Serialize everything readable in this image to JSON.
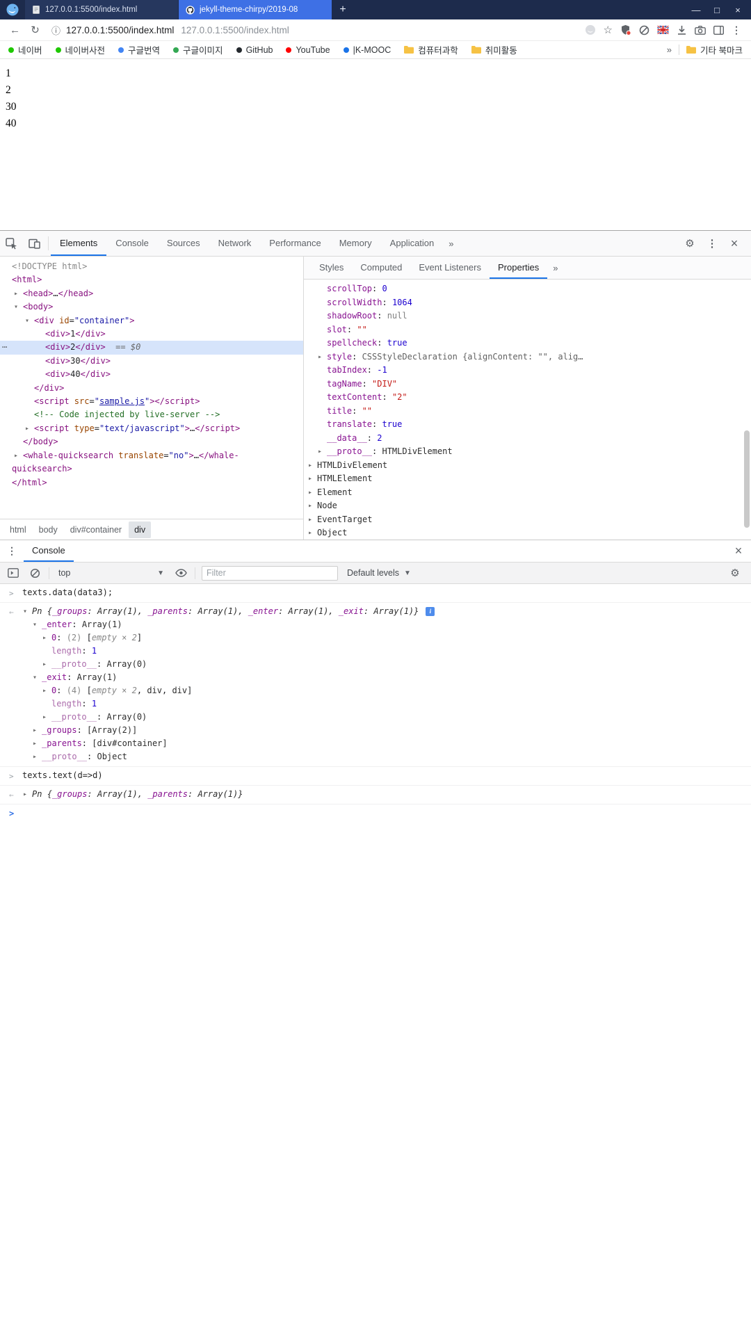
{
  "window": {
    "tabs": [
      {
        "title": "127.0.0.1:5500/index.html",
        "active": false
      },
      {
        "title": "jekyll-theme-chirpy/2019-08",
        "active": true
      }
    ],
    "new_tab_label": "+",
    "controls": {
      "minimize": "—",
      "maximize": "□",
      "close": "×"
    }
  },
  "addressbar": {
    "back_icon": "←",
    "reload_icon": "↻",
    "info_icon": "ⓘ",
    "url_primary": "127.0.0.1:5500/index.html",
    "url_secondary": "127.0.0.1:5500/index.html",
    "star_icon": "☆",
    "menu_icon": "⋮"
  },
  "bookmarks": {
    "items": [
      {
        "label": "네이버",
        "icon": "dot",
        "color": "#1ec800"
      },
      {
        "label": "네이버사전",
        "icon": "dot",
        "color": "#1ec800"
      },
      {
        "label": "구글번역",
        "icon": "dot",
        "color": "#4285f4"
      },
      {
        "label": "구글이미지",
        "icon": "dot",
        "color": "#34a853"
      },
      {
        "label": "GitHub",
        "icon": "dot",
        "color": "#24292e"
      },
      {
        "label": "YouTube",
        "icon": "dot",
        "color": "#ff0000"
      },
      {
        "label": "|K-MOOC",
        "icon": "dot",
        "color": "#1a73e8"
      },
      {
        "label": "컴퓨터과학",
        "icon": "folder",
        "color": "#f6c244"
      },
      {
        "label": "취미활동",
        "icon": "folder",
        "color": "#f6c244"
      }
    ],
    "overflow_icon": "»",
    "other_bookmarks": {
      "label": "기타 북마크"
    }
  },
  "page": {
    "lines": [
      "1",
      "2",
      "30",
      "40"
    ]
  },
  "devtools": {
    "tabbar": {
      "tabs": [
        "Elements",
        "Console",
        "Sources",
        "Network",
        "Performance",
        "Memory",
        "Application"
      ],
      "active": "Elements",
      "overflow_icon": "»",
      "settings_icon": "⚙",
      "menu_icon": "⋮",
      "close_icon": "×"
    },
    "dom_tree": [
      {
        "ind": 0,
        "seg": [
          [
            "<!DOCTYPE html>",
            "gray"
          ]
        ]
      },
      {
        "ind": 0,
        "seg": [
          [
            "<html>",
            "tag"
          ]
        ]
      },
      {
        "ind": 1,
        "arrow": "closed",
        "seg": [
          [
            "<head>",
            "tag"
          ],
          [
            "…",
            "txt"
          ],
          [
            "</head>",
            "tag"
          ]
        ]
      },
      {
        "ind": 1,
        "arrow": "open",
        "seg": [
          [
            "<body>",
            "tag"
          ]
        ]
      },
      {
        "ind": 2,
        "arrow": "open",
        "seg": [
          [
            "<div ",
            "tag"
          ],
          [
            "id",
            "attr"
          ],
          [
            "=",
            "txt"
          ],
          [
            "\"container\"",
            "val"
          ],
          [
            ">",
            "tag"
          ]
        ]
      },
      {
        "ind": 3,
        "seg": [
          [
            "<div>",
            "tag"
          ],
          [
            "1",
            "txt"
          ],
          [
            "</div>",
            "tag"
          ]
        ]
      },
      {
        "ind": 3,
        "sel": true,
        "dots": true,
        "seg": [
          [
            "<div>",
            "tag"
          ],
          [
            "2",
            "txt"
          ],
          [
            "</div>",
            "tag"
          ],
          [
            "  ",
            "txt"
          ],
          [
            "== $0",
            "meta"
          ]
        ]
      },
      {
        "ind": 3,
        "seg": [
          [
            "<div>",
            "tag"
          ],
          [
            "30",
            "txt"
          ],
          [
            "</div>",
            "tag"
          ]
        ]
      },
      {
        "ind": 3,
        "seg": [
          [
            "<div>",
            "tag"
          ],
          [
            "40",
            "txt"
          ],
          [
            "</div>",
            "tag"
          ]
        ]
      },
      {
        "ind": 2,
        "seg": [
          [
            "</div>",
            "tag"
          ]
        ]
      },
      {
        "ind": 2,
        "seg": [
          [
            "<script ",
            "tag"
          ],
          [
            "src",
            "attr"
          ],
          [
            "=",
            "txt"
          ],
          [
            "\"",
            "val"
          ],
          [
            "sample.js",
            "link"
          ],
          [
            "\"",
            "val"
          ],
          [
            ">",
            "tag"
          ],
          [
            "</script>",
            "tag"
          ]
        ]
      },
      {
        "ind": 2,
        "seg": [
          [
            "<!-- Code injected by live-server -->",
            "com"
          ]
        ]
      },
      {
        "ind": 2,
        "arrow": "closed",
        "seg": [
          [
            "<script ",
            "tag"
          ],
          [
            "type",
            "attr"
          ],
          [
            "=",
            "txt"
          ],
          [
            "\"text/javascript\"",
            "val"
          ],
          [
            ">",
            "tag"
          ],
          [
            "…",
            "txt"
          ],
          [
            "</script>",
            "tag"
          ]
        ]
      },
      {
        "ind": 1,
        "seg": [
          [
            "</body>",
            "tag"
          ]
        ]
      },
      {
        "ind": 1,
        "arrow": "closed",
        "seg": [
          [
            "<whale-quicksearch ",
            "tag"
          ],
          [
            "translate",
            "attr"
          ],
          [
            "=",
            "txt"
          ],
          [
            "\"no\"",
            "val"
          ],
          [
            ">",
            "tag"
          ],
          [
            "…",
            "txt"
          ],
          [
            "</whale-",
            "tag"
          ]
        ]
      },
      {
        "ind": 0,
        "seg": [
          [
            "quicksearch>",
            "tag"
          ]
        ]
      },
      {
        "ind": 0,
        "seg": [
          [
            "</html>",
            "tag"
          ]
        ]
      }
    ],
    "sidebar": {
      "tabs": [
        "Styles",
        "Computed",
        "Event Listeners",
        "Properties"
      ],
      "active": "Properties",
      "overflow_icon": "»",
      "properties": [
        {
          "lvl": 1,
          "seg": [
            [
              "scrollTop",
              "name"
            ],
            [
              ": ",
              "txt"
            ],
            [
              "0",
              "num"
            ]
          ]
        },
        {
          "lvl": 1,
          "seg": [
            [
              "scrollWidth",
              "name"
            ],
            [
              ": ",
              "txt"
            ],
            [
              "1064",
              "num"
            ]
          ]
        },
        {
          "lvl": 1,
          "seg": [
            [
              "shadowRoot",
              "name"
            ],
            [
              ": ",
              "txt"
            ],
            [
              "null",
              "null"
            ]
          ]
        },
        {
          "lvl": 1,
          "seg": [
            [
              "slot",
              "name"
            ],
            [
              ": ",
              "txt"
            ],
            [
              "\"\"",
              "str"
            ]
          ]
        },
        {
          "lvl": 1,
          "seg": [
            [
              "spellcheck",
              "name"
            ],
            [
              ": ",
              "txt"
            ],
            [
              "true",
              "num"
            ]
          ]
        },
        {
          "lvl": 1,
          "arrow": true,
          "seg": [
            [
              "style",
              "name"
            ],
            [
              ": ",
              "txt"
            ],
            [
              "CSSStyleDeclaration {alignContent: \"\", alig…",
              "prev"
            ]
          ]
        },
        {
          "lvl": 1,
          "seg": [
            [
              "tabIndex",
              "name"
            ],
            [
              ": ",
              "txt"
            ],
            [
              "-1",
              "num"
            ]
          ]
        },
        {
          "lvl": 1,
          "seg": [
            [
              "tagName",
              "name"
            ],
            [
              ": ",
              "txt"
            ],
            [
              "\"DIV\"",
              "str"
            ]
          ]
        },
        {
          "lvl": 1,
          "seg": [
            [
              "textContent",
              "name"
            ],
            [
              ": ",
              "txt"
            ],
            [
              "\"2\"",
              "str"
            ]
          ]
        },
        {
          "lvl": 1,
          "seg": [
            [
              "title",
              "name"
            ],
            [
              ": ",
              "txt"
            ],
            [
              "\"\"",
              "str"
            ]
          ]
        },
        {
          "lvl": 1,
          "seg": [
            [
              "translate",
              "name"
            ],
            [
              ": ",
              "txt"
            ],
            [
              "true",
              "num"
            ]
          ]
        },
        {
          "lvl": 1,
          "seg": [
            [
              "__data__",
              "name"
            ],
            [
              ": ",
              "txt"
            ],
            [
              "2",
              "num"
            ]
          ]
        },
        {
          "lvl": 1,
          "arrow": true,
          "seg": [
            [
              "__proto__",
              "name"
            ],
            [
              ": ",
              "txt"
            ],
            [
              "HTMLDivElement",
              "obj"
            ]
          ]
        },
        {
          "lvl": 0,
          "arrow": true,
          "seg": [
            [
              "HTMLDivElement",
              "obj"
            ]
          ]
        },
        {
          "lvl": 0,
          "arrow": true,
          "seg": [
            [
              "HTMLElement",
              "obj"
            ]
          ]
        },
        {
          "lvl": 0,
          "arrow": true,
          "seg": [
            [
              "Element",
              "obj"
            ]
          ]
        },
        {
          "lvl": 0,
          "arrow": true,
          "seg": [
            [
              "Node",
              "obj"
            ]
          ]
        },
        {
          "lvl": 0,
          "arrow": true,
          "seg": [
            [
              "EventTarget",
              "obj"
            ]
          ]
        },
        {
          "lvl": 0,
          "arrow": true,
          "seg": [
            [
              "Object",
              "obj"
            ]
          ]
        }
      ]
    },
    "breadcrumbs": {
      "items": [
        "html",
        "body",
        "div#container",
        "div"
      ],
      "selected": "div"
    },
    "console": {
      "title": "Console",
      "context": "top",
      "filter_placeholder": "Filter",
      "levels_label": "Default levels",
      "entries": [
        {
          "kind": "command",
          "text": "texts.data(data3);"
        },
        {
          "kind": "result",
          "rows": [
            {
              "ind": 0,
              "arrow": "open",
              "info": true,
              "seg": [
                [
                  "Pn ",
                  "pv"
                ],
                [
                  "{",
                  "pv"
                ],
                [
                  "_groups",
                  "pvn"
                ],
                [
                  ": Array(1), ",
                  "pv"
                ],
                [
                  "_parents",
                  "pvn"
                ],
                [
                  ": Array(1), ",
                  "pv"
                ],
                [
                  "_enter",
                  "pvn"
                ],
                [
                  ": Array(1), ",
                  "pv"
                ],
                [
                  "_exit",
                  "pvn"
                ],
                [
                  ": Array(1)}",
                  "pv"
                ]
              ]
            },
            {
              "ind": 1,
              "arrow": "open",
              "seg": [
                [
                  "_enter",
                  "name"
                ],
                [
                  ": ",
                  "txt"
                ],
                [
                  "Array(1)",
                  "obj"
                ]
              ]
            },
            {
              "ind": 2,
              "arrow": "closed",
              "seg": [
                [
                  "0",
                  "name"
                ],
                [
                  ": ",
                  "txt"
                ],
                [
                  "(2) ",
                  "gray"
                ],
                [
                  "[",
                  "txt"
                ],
                [
                  "empty × 2",
                  "grayit"
                ],
                [
                  "]",
                  "txt"
                ]
              ]
            },
            {
              "ind": 2,
              "seg": [
                [
                  "length",
                  "name2"
                ],
                [
                  ": ",
                  "txt"
                ],
                [
                  "1",
                  "num"
                ]
              ]
            },
            {
              "ind": 2,
              "arrow": "closed",
              "seg": [
                [
                  "__proto__",
                  "name2"
                ],
                [
                  ": ",
                  "txt"
                ],
                [
                  "Array(0)",
                  "obj"
                ]
              ]
            },
            {
              "ind": 1,
              "arrow": "open",
              "seg": [
                [
                  "_exit",
                  "name"
                ],
                [
                  ": ",
                  "txt"
                ],
                [
                  "Array(1)",
                  "obj"
                ]
              ]
            },
            {
              "ind": 2,
              "arrow": "closed",
              "seg": [
                [
                  "0",
                  "name"
                ],
                [
                  ": ",
                  "txt"
                ],
                [
                  "(4) ",
                  "gray"
                ],
                [
                  "[",
                  "txt"
                ],
                [
                  "empty × 2",
                  "grayit"
                ],
                [
                  ", ",
                  "txt"
                ],
                [
                  "div",
                  "obj"
                ],
                [
                  ", ",
                  "txt"
                ],
                [
                  "div",
                  "obj"
                ],
                [
                  "]",
                  "txt"
                ]
              ]
            },
            {
              "ind": 2,
              "seg": [
                [
                  "length",
                  "name2"
                ],
                [
                  ": ",
                  "txt"
                ],
                [
                  "1",
                  "num"
                ]
              ]
            },
            {
              "ind": 2,
              "arrow": "closed",
              "seg": [
                [
                  "__proto__",
                  "name2"
                ],
                [
                  ": ",
                  "txt"
                ],
                [
                  "Array(0)",
                  "obj"
                ]
              ]
            },
            {
              "ind": 1,
              "arrow": "closed",
              "seg": [
                [
                  "_groups",
                  "name"
                ],
                [
                  ": ",
                  "txt"
                ],
                [
                  "[Array(2)]",
                  "obj"
                ]
              ]
            },
            {
              "ind": 1,
              "arrow": "closed",
              "seg": [
                [
                  "_parents",
                  "name"
                ],
                [
                  ": ",
                  "txt"
                ],
                [
                  "[div#container]",
                  "obj"
                ]
              ]
            },
            {
              "ind": 1,
              "arrow": "closed",
              "seg": [
                [
                  "__proto__",
                  "name2"
                ],
                [
                  ": ",
                  "txt"
                ],
                [
                  "Object",
                  "obj"
                ]
              ]
            }
          ]
        },
        {
          "kind": "command",
          "text": "texts.text(d=>d)"
        },
        {
          "kind": "result",
          "rows": [
            {
              "ind": 0,
              "arrow": "closed",
              "seg": [
                [
                  "Pn ",
                  "pv"
                ],
                [
                  "{",
                  "pv"
                ],
                [
                  "_groups",
                  "pvn"
                ],
                [
                  ": Array(1), ",
                  "pv"
                ],
                [
                  "_parents",
                  "pvn"
                ],
                [
                  ": Array(1)}",
                  "pv"
                ]
              ]
            }
          ]
        },
        {
          "kind": "prompt"
        }
      ]
    }
  }
}
